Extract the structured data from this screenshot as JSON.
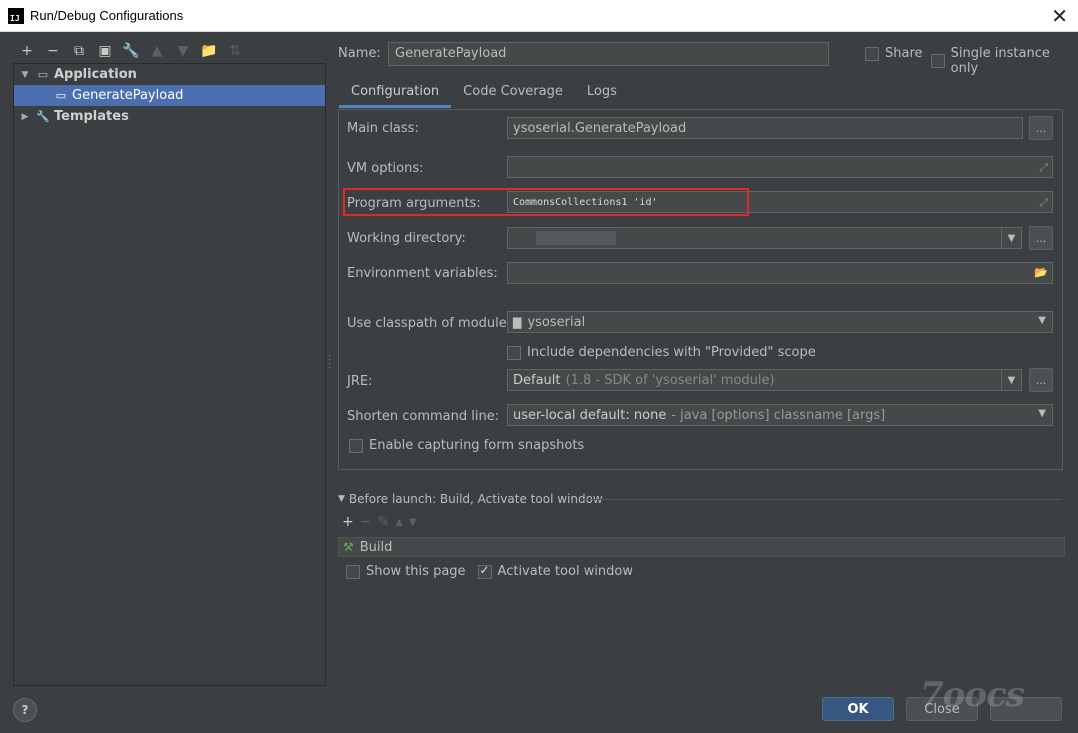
{
  "window": {
    "title": "Run/Debug Configurations",
    "app_icon": "IJ"
  },
  "tree": {
    "application": "Application",
    "generate_payload": "GeneratePayload",
    "templates": "Templates"
  },
  "name": {
    "label": "Name:",
    "value": "GeneratePayload"
  },
  "share": {
    "label": "Share",
    "checked": false
  },
  "single_instance": {
    "label": "Single instance only",
    "checked": false
  },
  "tabs": [
    "Configuration",
    "Code Coverage",
    "Logs"
  ],
  "fields": {
    "main_class": {
      "label": "Main class:",
      "value": "ysoserial.GeneratePayload"
    },
    "vm_options": {
      "label": "VM options:",
      "value": ""
    },
    "program_arguments": {
      "label": "Program arguments:",
      "value": "CommonsCollections1 'id'"
    },
    "working_directory": {
      "label": "Working directory:",
      "value": ""
    },
    "environment_variables": {
      "label": "Environment variables:",
      "value": ""
    },
    "classpath_module": {
      "label": "Use classpath of module:",
      "value": "ysoserial"
    },
    "include_dependencies": {
      "label": "Include dependencies with \"Provided\" scope",
      "checked": false
    },
    "jre": {
      "label": "JRE:",
      "value": "Default",
      "hint": "(1.8 - SDK of 'ysoserial' module)"
    },
    "shorten_command_line": {
      "label": "Shorten command line:",
      "value": "user-local default: none",
      "hint": "- java [options] classname [args]"
    },
    "enable_snapshots": {
      "label": "Enable capturing form snapshots",
      "checked": false
    }
  },
  "before_launch": {
    "header": "Before launch: Build, Activate tool window",
    "items": [
      "Build"
    ],
    "show_this_page": {
      "label": "Show this page",
      "checked": false
    },
    "activate_tool_window": {
      "label": "Activate tool window",
      "checked": true
    }
  },
  "buttons": {
    "ok": "OK",
    "close": "Close",
    "help": "?"
  },
  "watermark": "7oocs",
  "colors": {
    "accent": "#4b6eaf",
    "ok_button": "#365880",
    "highlight": "#e02a2a"
  }
}
